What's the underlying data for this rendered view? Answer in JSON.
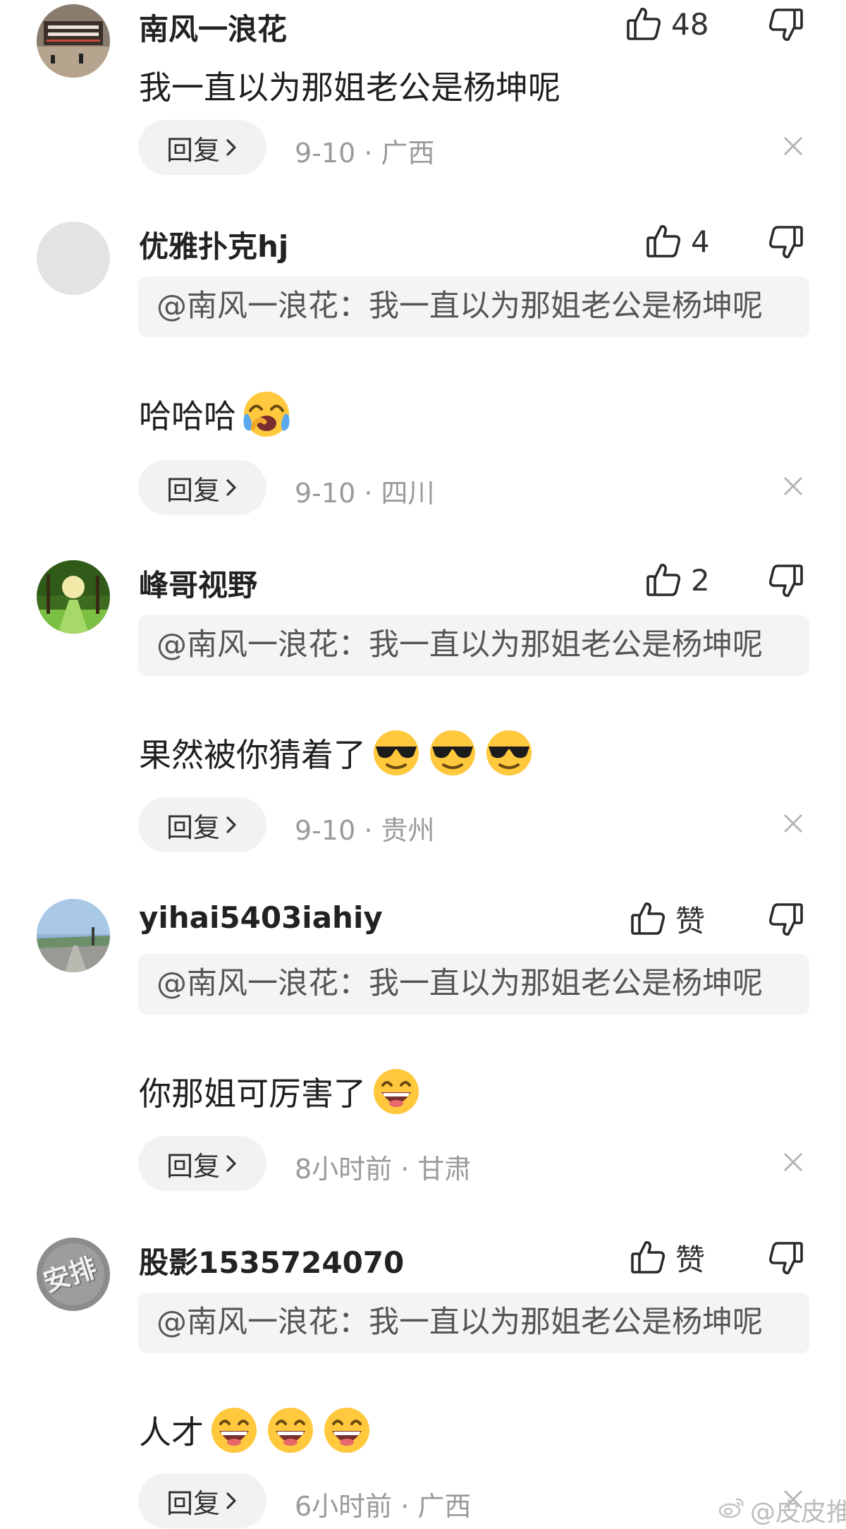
{
  "comments": [
    {
      "username": "南风一浪花",
      "avatar": "avatar-poster-image",
      "likes": "48",
      "quote": "",
      "text": "我一直以为那姐老公是杨坤呢",
      "reply_label": "回复",
      "meta": "9-10 · 广西"
    },
    {
      "username": "优雅扑克hj",
      "avatar": "avatar-gray-placeholder",
      "likes": "4",
      "quote": "@南风一浪花：我一直以为那姐老公是杨坤呢",
      "text": "哈哈哈",
      "emoji": "laughing-crying-emoji",
      "reply_label": "回复",
      "meta": "9-10 · 四川"
    },
    {
      "username": "峰哥视野",
      "avatar": "avatar-tree-road",
      "likes": "2",
      "quote": "@南风一浪花：我一直以为那姐老公是杨坤呢",
      "text": "果然被你猜着了",
      "emoji": "sunglasses-emoji",
      "reply_label": "回复",
      "meta": "9-10 · 贵州"
    },
    {
      "username": "yihai5403iahiy",
      "avatar": "avatar-sky-road",
      "likes": "赞",
      "quote": "@南风一浪花：我一直以为那姐老公是杨坤呢",
      "text": "你那姐可厉害了",
      "emoji": "grinning-emoji",
      "reply_label": "回复",
      "meta": "8小时前 · 甘肃"
    },
    {
      "username": "股影1535724070",
      "avatar": "avatar-anpai-logo",
      "avatar_text": "安排",
      "likes": "赞",
      "quote": "@南风一浪花：我一直以为那姐老公是杨坤呢",
      "text": "人才",
      "emoji": "grinning-emoji",
      "reply_label": "回复",
      "meta": "6小时前 · 广西"
    }
  ],
  "watermark": "@皮皮推",
  "colors": {
    "background": "#ffffff",
    "quote_background": "#f4f4f4",
    "button_background": "#f2f2f2",
    "meta_text": "#9a9a9a"
  }
}
